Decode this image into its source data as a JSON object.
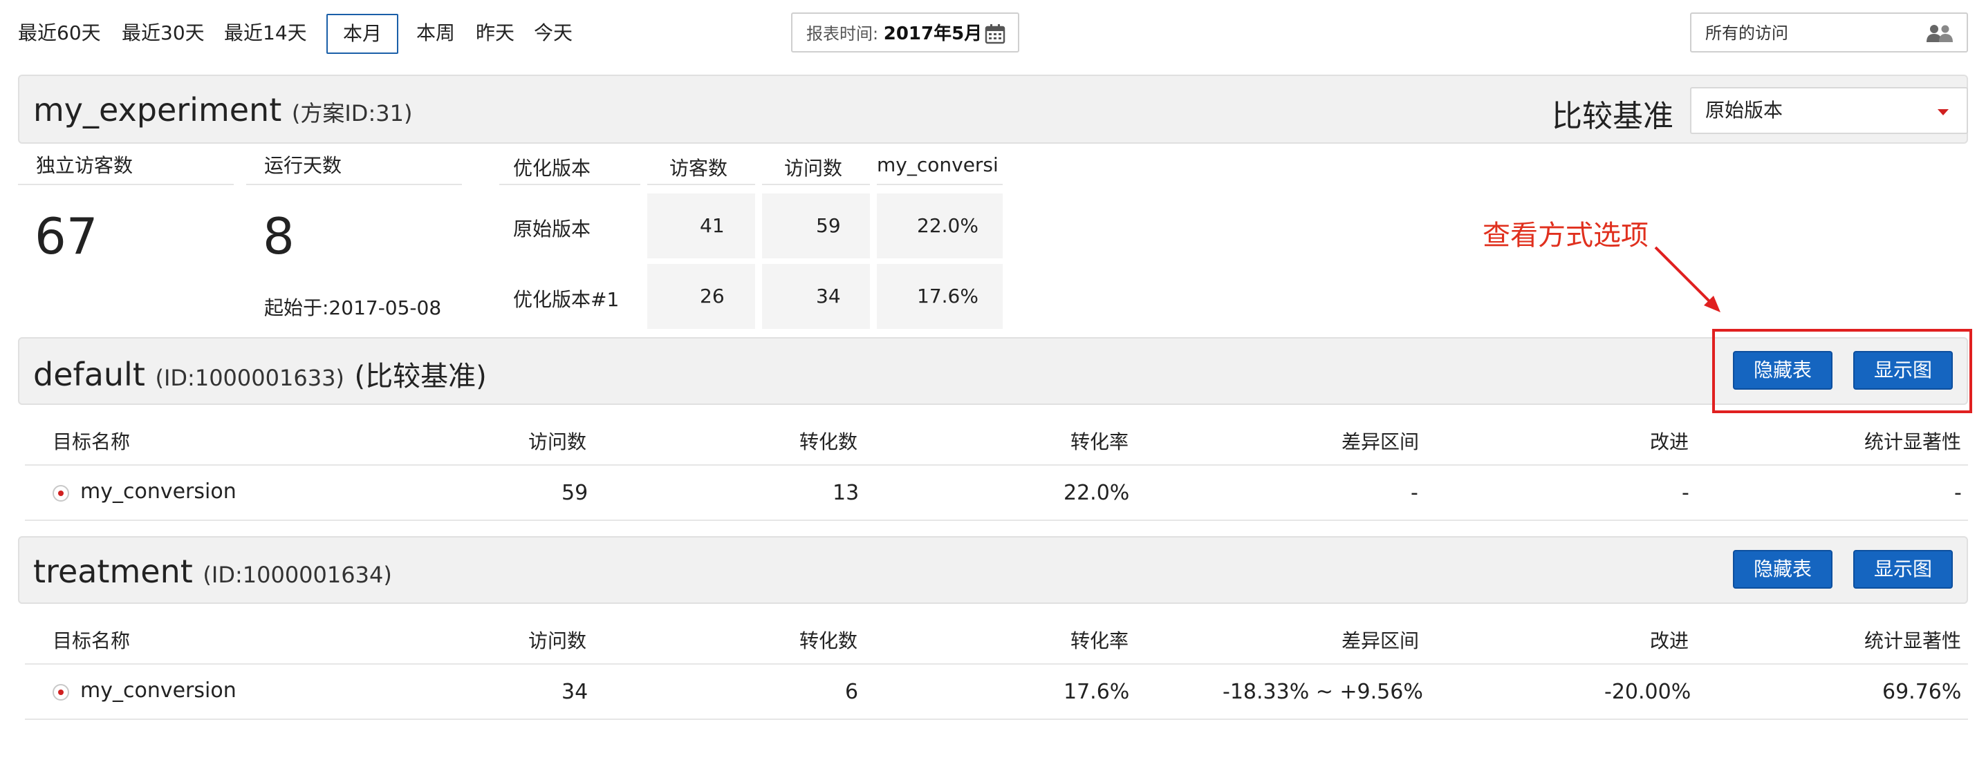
{
  "topbar": {
    "ranges": [
      "最近60天",
      "最近30天",
      "最近14天",
      "本月",
      "本周",
      "昨天",
      "今天"
    ],
    "active_range": "本月",
    "report_time_label": "报表时间:",
    "report_time_value": "2017年5月",
    "visits_filter": "所有的访问"
  },
  "experiment": {
    "name": "my_experiment",
    "scheme_id": "(方案ID:31)",
    "baseline_label": "比较基准",
    "baseline_select": "原始版本"
  },
  "summary": {
    "unique_visitors_label": "独立访客数",
    "unique_visitors": "67",
    "run_days_label": "运行天数",
    "run_days": "8",
    "start_label": "起始于:2017-05-08",
    "table": {
      "headers": [
        "优化版本",
        "访客数",
        "访问数",
        "my_conversi"
      ],
      "rows": [
        [
          "原始版本",
          "41",
          "59",
          "22.0%"
        ],
        [
          "优化版本#1",
          "26",
          "34",
          "17.6%"
        ]
      ]
    }
  },
  "annotation": "查看方式选项",
  "buttons": {
    "hide_table": "隐藏表",
    "show_chart": "显示图"
  },
  "goal_headers": [
    "目标名称",
    "访问数",
    "转化数",
    "转化率",
    "差异区间",
    "改进",
    "统计显著性"
  ],
  "variants": [
    {
      "name": "default",
      "id_text": "(ID:1000001633)",
      "baseline_tag": "(比较基准)",
      "row": [
        "my_conversion",
        "59",
        "13",
        "22.0%",
        "-",
        "-",
        "-"
      ]
    },
    {
      "name": "treatment",
      "id_text": "(ID:1000001634)",
      "baseline_tag": "",
      "row": [
        "my_conversion",
        "34",
        "6",
        "17.6%",
        "-18.33% ~ +9.56%",
        "-20.00%",
        "69.76%"
      ]
    }
  ],
  "colors": {
    "button_blue": "#1565c0",
    "annotation_red": "#e02020",
    "bar_gray": "#f1f1f1"
  },
  "icons": {
    "calendar": "calendar-icon",
    "users": "users-icon",
    "caret": "caret-down-icon",
    "radio": "radio-selected-icon",
    "arrow": "annotation-arrow-icon"
  }
}
